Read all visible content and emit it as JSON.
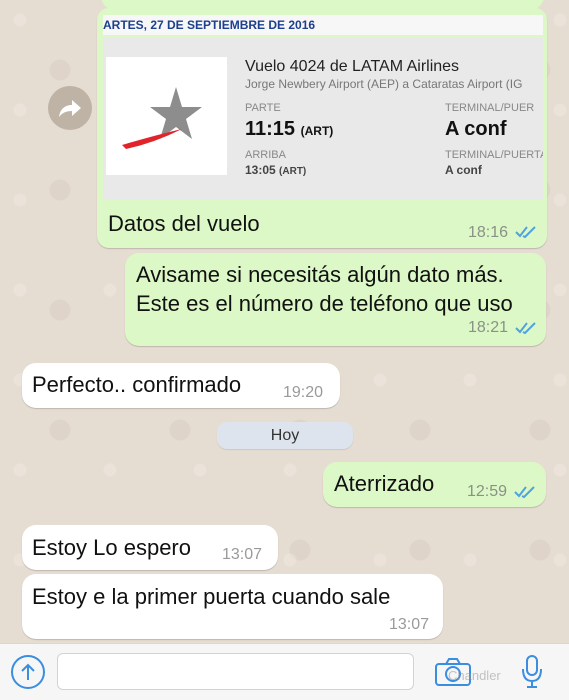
{
  "colors": {
    "outgoing_bubble": "#dcf8c6",
    "incoming_bubble": "#ffffff",
    "read_ticks": "#4fa3e0",
    "accent": "#3b8de0",
    "card_date_text": "#1c3f8e",
    "logo_red": "#e1242b",
    "logo_gray": "#8d8d8d"
  },
  "flight_card": {
    "date": "ARTES, 27 DE SEPTIEMBRE DE 2016",
    "airline": "Vuelo 4024 de LATAM Airlines",
    "route": "Jorge Newbery Airport (AEP) a Cataratas Airport (IG",
    "depart_label": "PARTE",
    "depart_time": "11:15",
    "depart_tz": "(ART)",
    "depart_terminal_label": "TERMINAL/PUER",
    "depart_terminal": "A conf",
    "arrive_label": "ARRIBA",
    "arrive_time": "13:05",
    "arrive_tz": "(ART)",
    "arrive_terminal_label": "TERMINAL/PUERTA",
    "arrive_terminal": "A conf",
    "logo_icon": "latam-star-logo",
    "share_icon": "share-forward-icon"
  },
  "messages": [
    {
      "direction": "out",
      "text": "Datos del vuelo",
      "time": "18:16",
      "read": true
    },
    {
      "direction": "out",
      "lines": [
        "Avisame si necesitás algún dato más.",
        "Este es el número de teléfono que uso"
      ],
      "time": "18:21",
      "read": true
    },
    {
      "direction": "in",
      "text": "Perfecto.. confirmado",
      "time": "19:20"
    },
    {
      "direction": "out",
      "text": "Aterrizado",
      "time": "12:59",
      "read": true
    },
    {
      "direction": "in",
      "text": "Estoy Lo espero",
      "time": "13:07"
    },
    {
      "direction": "in",
      "text": "Estoy e  la primer puerta cuando sale",
      "time": "13:07"
    }
  ],
  "date_divider": "Hoy",
  "input_bar": {
    "placeholder": "",
    "upload_icon": "upload-arrow-icon",
    "camera_icon": "camera-icon",
    "mic_icon": "microphone-icon",
    "watermark": "Chandler"
  }
}
